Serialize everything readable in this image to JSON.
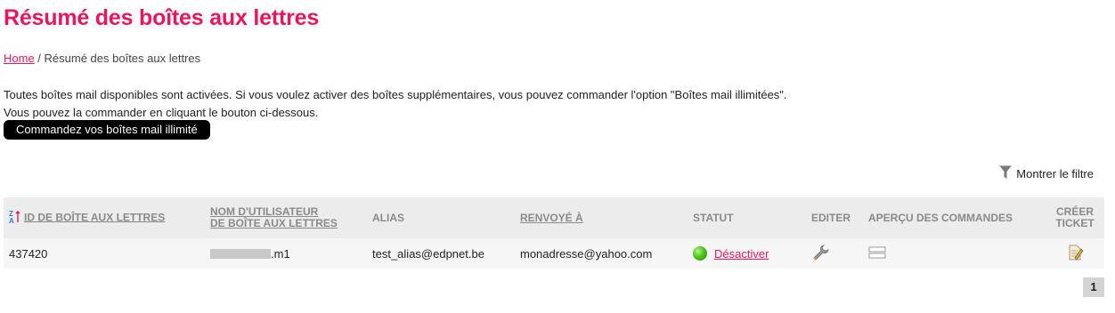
{
  "page": {
    "title": "Résumé des boîtes aux lettres"
  },
  "breadcrumb": {
    "home": "Home",
    "separator": " / ",
    "current": "Résumé des boîtes aux lettres"
  },
  "intro": {
    "line1": "Toutes boîtes mail disponibles sont activées. Si vous voulez activer des boîtes supplémentaires, vous pouvez commander l'option \"Boîtes mail illimitées\".",
    "line2": "Vous pouvez la commander en cliquant le bouton ci-dessous."
  },
  "order_button": "Commandez vos boîtes mail illimité",
  "filter": {
    "label": "Montrer le filtre",
    "icon": "funnel-icon"
  },
  "table": {
    "headers": {
      "id": "ID DE BOÎTE AUX LETTRES",
      "username_line1": "NOM D'UTILISATEUR",
      "username_line2": "DE BOÎTE AUX LETTRES",
      "alias": "ALIAS",
      "forwarded": "RENVOYÉ À",
      "status": "STATUT",
      "edit": "EDITER",
      "orders": "APERÇU DES COMMANDES",
      "ticket_line1": "CRÉER",
      "ticket_line2": "TICKET"
    },
    "rows": [
      {
        "id": "437420",
        "username_suffix": ".m1",
        "alias": "test_alias@edpnet.be",
        "forwarded": "monadresse@yahoo.com",
        "status_action": "Désactiver",
        "status_color": "#4cc41c"
      }
    ]
  },
  "pagination": {
    "current": "1"
  },
  "colors": {
    "accent": "#e8175d",
    "button_bg": "#000000"
  }
}
